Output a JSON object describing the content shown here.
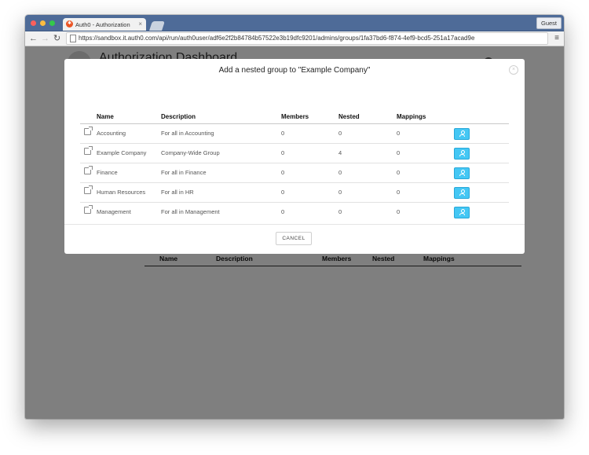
{
  "browser": {
    "tab_title": "Auth0 - Authorization",
    "tab_close": "×",
    "guest_label": "Guest",
    "url": "https://sandbox.it.auth0.com/api/run/auth0user/adf6e2f2b84784b57522e3b19dfc9201/admins/groups/1fa37bd6-f874-4ef9-bcd5-251a17acad9e",
    "back_glyph": "←",
    "forward_glyph": "→",
    "reload_glyph": "↻",
    "menu_glyph": "≡",
    "favicon_glyph": "✱"
  },
  "background_page": {
    "title": "Authorization Dashboard",
    "table_headers": [
      "Name",
      "Description",
      "Members",
      "Nested",
      "Mappings"
    ]
  },
  "modal": {
    "title": "Add a nested group to \"Example Company\"",
    "close_glyph": "×",
    "headers": {
      "name": "Name",
      "description": "Description",
      "members": "Members",
      "nested": "Nested",
      "mappings": "Mappings"
    },
    "rows": [
      {
        "name": "Accounting",
        "description": "For all in Accounting",
        "members": "0",
        "nested": "0",
        "mappings": "0"
      },
      {
        "name": "Example Company",
        "description": "Company-Wide Group",
        "members": "0",
        "nested": "4",
        "mappings": "0"
      },
      {
        "name": "Finance",
        "description": "For all in Finance",
        "members": "0",
        "nested": "0",
        "mappings": "0"
      },
      {
        "name": "Human Resources",
        "description": "For all in HR",
        "members": "0",
        "nested": "0",
        "mappings": "0"
      },
      {
        "name": "Management",
        "description": "For all in Management",
        "members": "0",
        "nested": "0",
        "mappings": "0"
      }
    ],
    "cancel_label": "CANCEL"
  },
  "icons": {
    "row_link": "external-link-icon",
    "row_action": "add-user-icon"
  },
  "colors": {
    "titlebar": "#4e6b98",
    "action_button": "#44c7f4",
    "brand": "#eb5424"
  }
}
